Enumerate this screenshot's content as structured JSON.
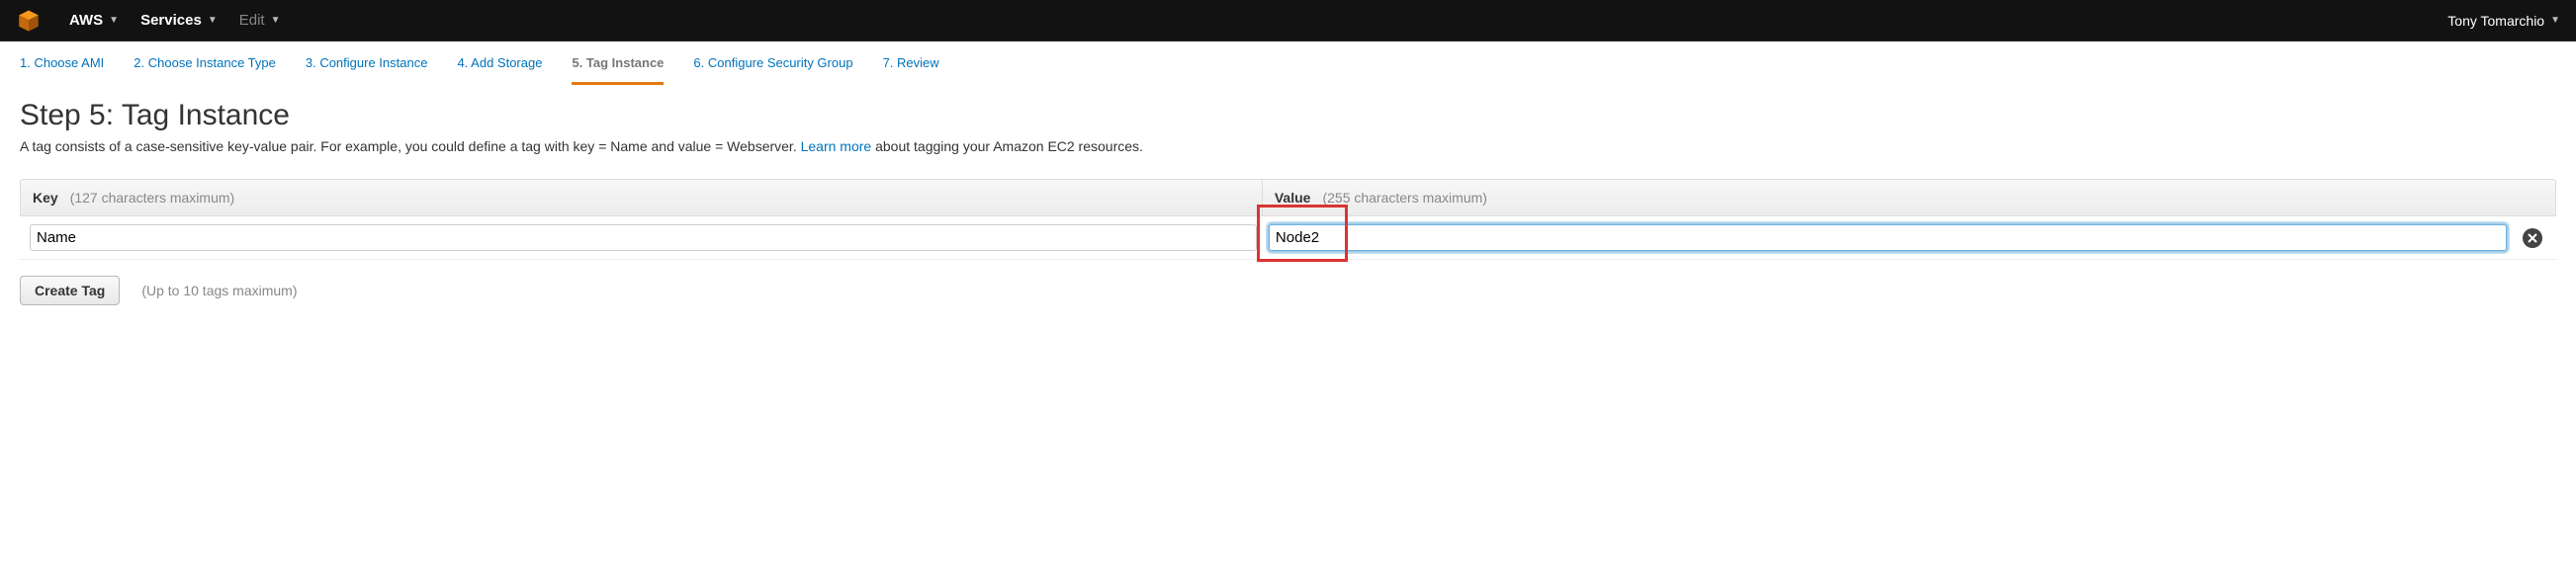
{
  "topnav": {
    "brand": "AWS",
    "services": "Services",
    "edit": "Edit",
    "user": "Tony Tomarchio"
  },
  "steps": [
    "1. Choose AMI",
    "2. Choose Instance Type",
    "3. Configure Instance",
    "4. Add Storage",
    "5. Tag Instance",
    "6. Configure Security Group",
    "7. Review"
  ],
  "active_step_index": 4,
  "page_title": "Step 5: Tag Instance",
  "description_prefix": "A tag consists of a case-sensitive key-value pair. For example, you could define a tag with key = Name and value = Webserver. ",
  "learn_more": "Learn more",
  "description_suffix": " about tagging your Amazon EC2 resources.",
  "table": {
    "key_label": "Key",
    "key_hint": "(127 characters maximum)",
    "value_label": "Value",
    "value_hint": "(255 characters maximum)",
    "rows": [
      {
        "key": "Name",
        "value": "Node2"
      }
    ]
  },
  "create_tag_label": "Create Tag",
  "max_hint": "(Up to 10 tags maximum)"
}
